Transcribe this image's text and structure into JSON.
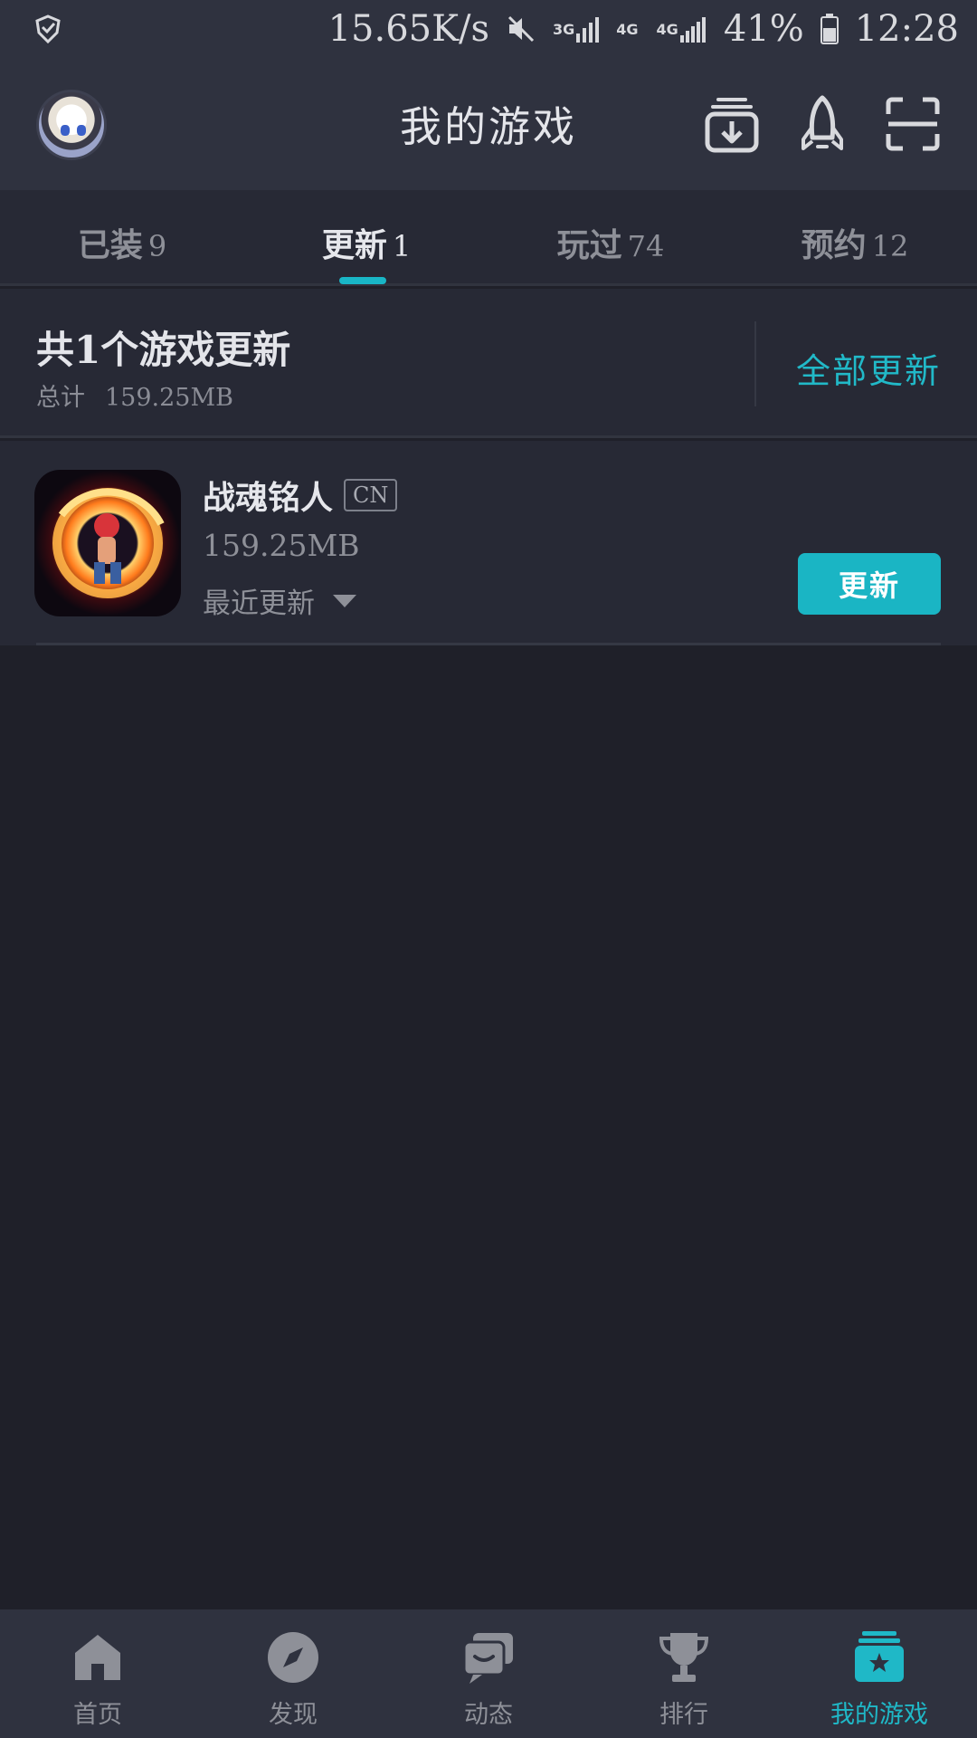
{
  "status_bar": {
    "speed": "15.65K/s",
    "signal_1": "3G",
    "signal_2": "4G",
    "signal_3": "4G",
    "battery": "41%",
    "time": "12:28"
  },
  "header": {
    "title": "我的游戏"
  },
  "tabs": [
    {
      "label": "已装",
      "count": "9"
    },
    {
      "label": "更新",
      "count": "1",
      "active": true
    },
    {
      "label": "玩过",
      "count": "74"
    },
    {
      "label": "预约",
      "count": "12"
    }
  ],
  "summary": {
    "title": "共1个游戏更新",
    "total_label": "总计",
    "total_value": "159.25MB",
    "update_all": "全部更新"
  },
  "games": [
    {
      "name": "战魂铭人",
      "region": "CN",
      "size": "159.25MB",
      "recent_label": "最近更新",
      "button": "更新"
    }
  ],
  "bottom_nav": [
    {
      "label": "首页",
      "icon": "home-icon"
    },
    {
      "label": "发现",
      "icon": "compass-icon"
    },
    {
      "label": "动态",
      "icon": "chat-icon"
    },
    {
      "label": "排行",
      "icon": "trophy-icon"
    },
    {
      "label": "我的游戏",
      "icon": "game-stack-icon",
      "active": true
    }
  ],
  "colors": {
    "accent": "#1ab5c4",
    "background": "#1f2029",
    "bar": "#2f323f"
  }
}
